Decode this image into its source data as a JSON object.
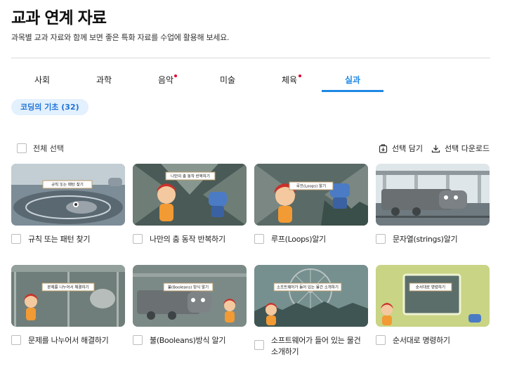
{
  "header": {
    "title": "교과 연계 자료",
    "description": "과목별 교과 자료와 함께 보면 좋은 특화 자료를 수업에 활용해 보세요."
  },
  "tabs": [
    {
      "label": "사회",
      "new": false,
      "active": false
    },
    {
      "label": "과학",
      "new": false,
      "active": false
    },
    {
      "label": "음악",
      "new": true,
      "active": false
    },
    {
      "label": "미술",
      "new": false,
      "active": false
    },
    {
      "label": "체육",
      "new": true,
      "active": false
    },
    {
      "label": "실과",
      "new": false,
      "active": true
    }
  ],
  "category_chip": "코딩의 기초 (32)",
  "toolbar": {
    "select_all": "전체 선택",
    "add_selected": "선택 담기",
    "download_selected": "선택 다운로드"
  },
  "items": [
    {
      "title": "규칙 또는 패턴 찾기",
      "scene_label": "규칙 또는 패턴 찾기"
    },
    {
      "title": "나만의 춤 동작 반복하기",
      "scene_label": "나만의 춤 동작 반복하기"
    },
    {
      "title": "루프(Loops)알기",
      "scene_label": "루프(Loops) 알기"
    },
    {
      "title": "문자열(strings)알기",
      "scene_label": ""
    },
    {
      "title": "문제를 나누어서 해결하기",
      "scene_label": "문제를 나누어서 해결하기"
    },
    {
      "title": "불(Booleans)방식 알기",
      "scene_label": "불(Booleans) 방식 알기"
    },
    {
      "title": "소프트웨어가 들어 있는 물건 소개하기",
      "scene_label": "소프트웨어가 들어 있는 물건 소개하기"
    },
    {
      "title": "순서대로 명령하기",
      "scene_label": "순서대로 명령하기"
    }
  ],
  "colors": {
    "accent": "#1e88e5",
    "new_dot": "#e4002b",
    "chip_bg": "#e3f0fd"
  }
}
